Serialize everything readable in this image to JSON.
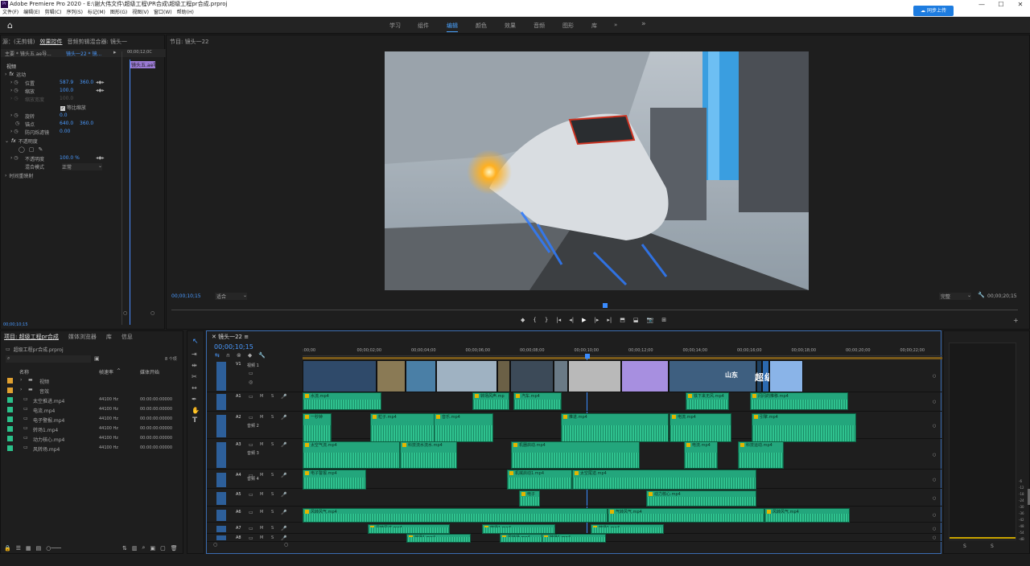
{
  "app": {
    "title": "Adobe Premiere Pro 2020 - E:\\谢大伟文件\\超级工程\\PR合成\\超级工程pr合成.prproj",
    "sync_button": "同步上传"
  },
  "menu": [
    "文件(F)",
    "编辑(E)",
    "剪辑(C)",
    "序列(S)",
    "标记(M)",
    "图形(G)",
    "视图(V)",
    "窗口(W)",
    "帮助(H)"
  ],
  "workspaces": [
    "学习",
    "组件",
    "编辑",
    "颜色",
    "效果",
    "音频",
    "图形",
    "库"
  ],
  "workspaces_active": "编辑",
  "effect_controls": {
    "tabs": [
      "源：(无剪辑)",
      "效果控件",
      "音频剪辑混合器: 镜头一",
      "节目:"
    ],
    "header_master": "主要 * 镜头五.ae导...",
    "header_seq": "镜头一22 * 镜...",
    "header_time": "00;00;12;0C",
    "clip_label": "镜头五.ae导",
    "section_video": "视频",
    "motion": "运动",
    "props": [
      {
        "name": "位置",
        "v1": "587.9",
        "v2": "360.0"
      },
      {
        "name": "缩放",
        "v1": "100.0",
        "v2": ""
      },
      {
        "name": "缩放宽度",
        "v1": "100.0",
        "v2": ""
      },
      {
        "name": "等比缩放",
        "v1": "",
        "v2": ""
      },
      {
        "name": "旋转",
        "v1": "0.0",
        "v2": ""
      },
      {
        "name": "锚点",
        "v1": "640.0",
        "v2": "360.0"
      },
      {
        "name": "防闪烁滤镜",
        "v1": "0.00",
        "v2": ""
      }
    ],
    "opacity": "不透明度",
    "opacity_prop": "不透明度",
    "opacity_val": "100.0 %",
    "blend_label": "混合模式",
    "blend_val": "正常",
    "time_remap": "时间重映射",
    "timecode": "00;00;10;15"
  },
  "program": {
    "tab": "节目: 镜头一22",
    "left_tc": "00;00;10;15",
    "fit": "适合",
    "quality": "完整",
    "right_tc": "00;00;20;15",
    "frame_text_a": "山东",
    "frame_text_b": "超级工程"
  },
  "project": {
    "tabs": [
      "项目: 超级工程pr合成",
      "媒体浏览器",
      "库",
      "信息"
    ],
    "file": "超级工程pr合成.prproj",
    "count": "8 个项",
    "columns": [
      "名称",
      "帧速率",
      "媒体开始"
    ],
    "items": [
      {
        "name": "视频",
        "rate": "",
        "start": "",
        "color": "#e0a030",
        "folder": true
      },
      {
        "name": "音效",
        "rate": "",
        "start": "",
        "color": "#e0a030",
        "folder": true
      },
      {
        "name": "太空推进.mp4",
        "rate": "44100 Hz",
        "start": "00:00:00:00000",
        "color": "#2bc08a"
      },
      {
        "name": "电流.mp4",
        "rate": "44100 Hz",
        "start": "00:00:00:00000",
        "color": "#2bc08a"
      },
      {
        "name": "电子警报.mp4",
        "rate": "44100 Hz",
        "start": "00:00:00:00000",
        "color": "#2bc08a"
      },
      {
        "name": "转场1.mp4",
        "rate": "44100 Hz",
        "start": "00:00:00:00000",
        "color": "#2bc08a"
      },
      {
        "name": "动力核心.mp4",
        "rate": "44100 Hz",
        "start": "00:00:00:00000",
        "color": "#2bc08a"
      },
      {
        "name": "风转场.mp4",
        "rate": "44100 Hz",
        "start": "00:00:00:00000",
        "color": "#2bc08a"
      }
    ]
  },
  "timeline": {
    "tab": "镜头一22",
    "timecode": "00;00;10;15",
    "ruler": [
      ":00;00",
      "00;00;02;00",
      "00;00;04;00",
      "00;00;06;00",
      "00;00;08;00",
      "00;00;10;00",
      "00;00;12;00",
      "00;00;14;00",
      "00;00;16;00",
      "00;00;18;00",
      "00;00;20;00",
      "00;00;22;00"
    ],
    "tracks": [
      {
        "id": "V1",
        "name": "视频 1"
      },
      {
        "id": "A1",
        "name": ""
      },
      {
        "id": "A2",
        "name": "音频 2"
      },
      {
        "id": "A3",
        "name": "音频 3"
      },
      {
        "id": "A4",
        "name": "音频 4"
      },
      {
        "id": "A5",
        "name": ""
      },
      {
        "id": "A6",
        "name": ""
      },
      {
        "id": "A7",
        "name": ""
      },
      {
        "id": "A8",
        "name": ""
      }
    ],
    "btn_m": "M",
    "btn_s": "S",
    "clips": [
      "水流.mp4",
      "转场风声.mp",
      "汽车.mp4",
      "铁下来无风.mp4",
      "闪闪的推移.mp4",
      "一秒钟",
      "粒子.mp4",
      "音乐.mp4",
      "引擎.mp4",
      "电流.mp4",
      "推进.mp4",
      "太空气流.mp4",
      "科技流水流水.mp4",
      "机器启动.mp4",
      "电流.mp4",
      "科技运动.mp4",
      "电子警报.mp4",
      "机械启动1.mp4",
      "太空尾迹.mp4",
      "电子",
      "动力核心.mp4",
      "风转风气.mp4",
      "气转风气.mp4",
      "风转风气.mp4",
      "风转风过.mp4",
      "转场1.mp4",
      "转场1.mp4",
      "转场1.mp4",
      "风转场.mp4",
      "转场1.mp4"
    ]
  },
  "meter": {
    "labels": [
      "-6",
      "-12",
      "-18",
      "-24",
      "-30",
      "-36",
      "-42",
      "-48",
      "-54",
      "-dB"
    ],
    "s1": "S",
    "s2": "S"
  }
}
